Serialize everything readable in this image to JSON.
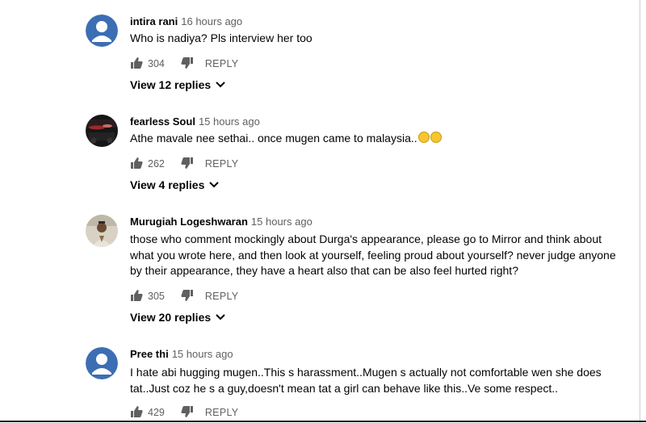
{
  "comments": [
    {
      "author": "intira rani",
      "time": "16 hours ago",
      "text": [
        "Who is nadiya? Pls interview her too"
      ],
      "likes": "304",
      "reply_label": "REPLY",
      "view_replies": "View 12 replies",
      "avatar": "default-avatar"
    },
    {
      "author": "fearless Soul",
      "time": "15 hours ago",
      "text": [
        "Athe mavale nee sethai.. once mugen came to malaysia.."
      ],
      "likes": "262",
      "reply_label": "REPLY",
      "view_replies": "View 4 replies",
      "avatar": "car-photo-avatar"
    },
    {
      "author": "Murugiah Logeshwaran",
      "time": "15 hours ago",
      "text": [
        "those who comment mockingly about Durga's appearance, please go to Mirror and think about",
        "what you wrote here, and then look at yourself, feeling proud about yourself? never judge anyone",
        "by their appearance, they have a  heart also that can be also feel hurted right?"
      ],
      "likes": "305",
      "reply_label": "REPLY",
      "view_replies": "View 20 replies",
      "avatar": "person-photo-avatar"
    },
    {
      "author": "Pree thi",
      "time": "15 hours ago",
      "text": [
        "I hate abi hugging mugen..This s harassment..Mugen s actually not comfortable wen she does",
        "tat..Just coz he s a guy,doesn't mean tat a girl can behave like this..Ve some respect.."
      ],
      "likes": "429",
      "reply_label": "REPLY",
      "avatar": "default-avatar"
    }
  ],
  "colors": {
    "avatar_blue": "#3c6eb4",
    "meta_gray": "#606060",
    "text": "#030303"
  }
}
